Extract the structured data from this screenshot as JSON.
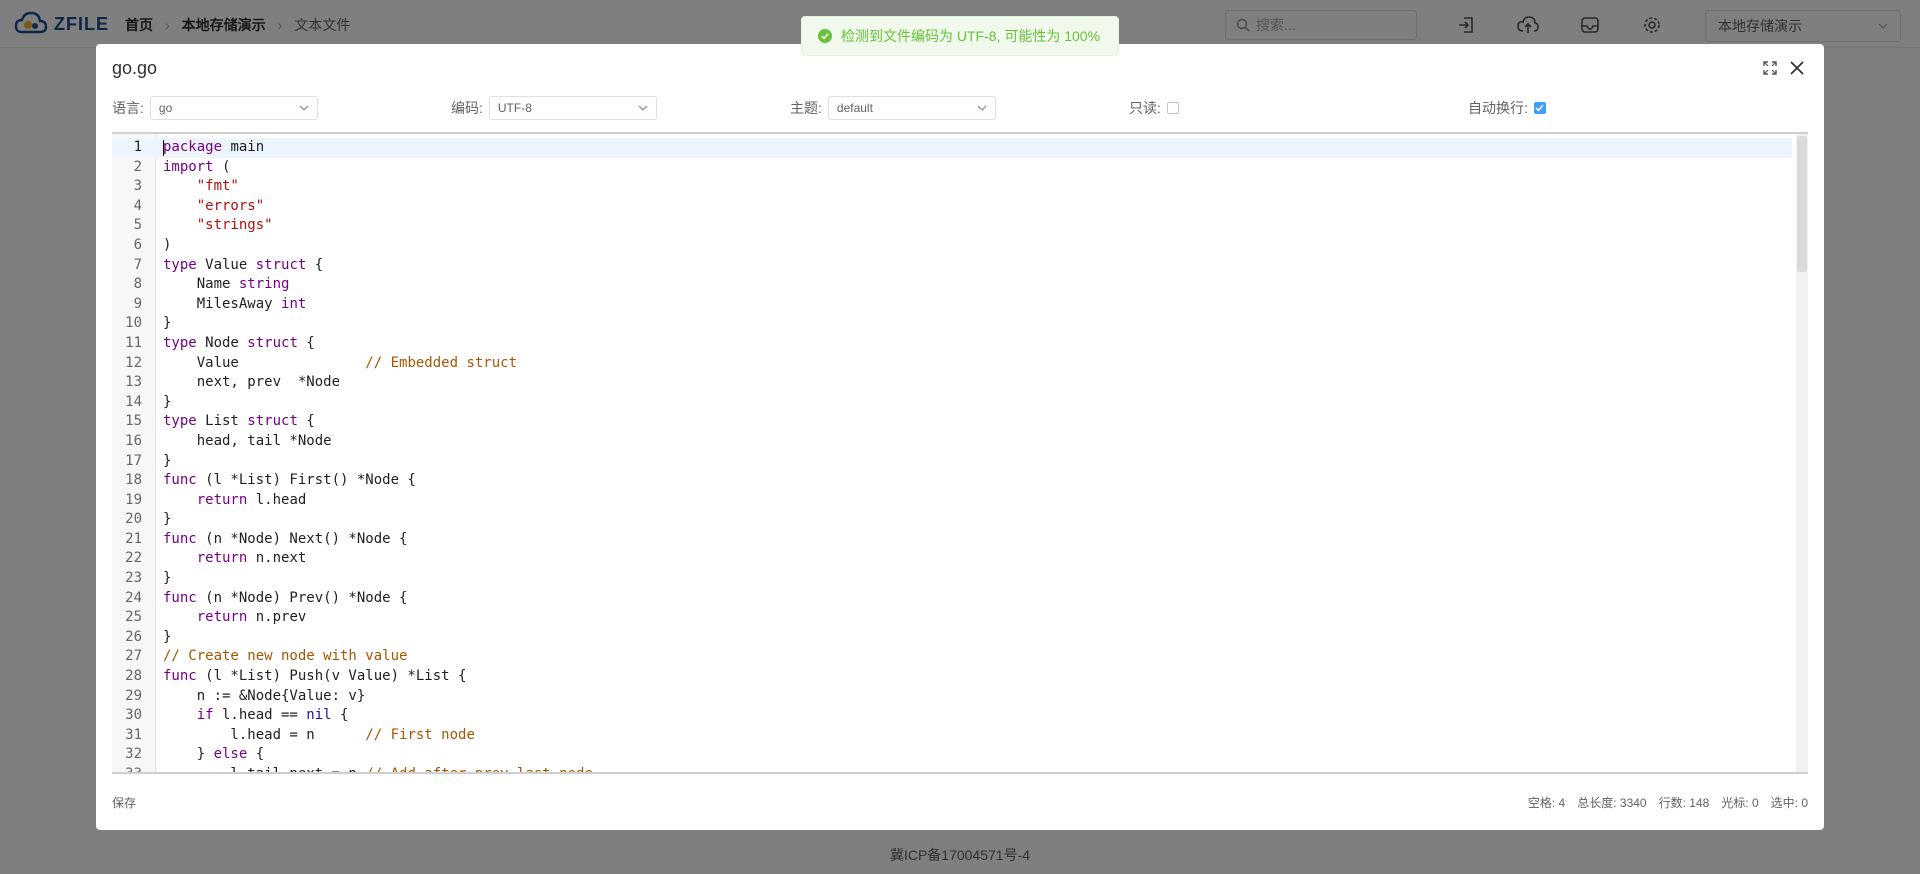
{
  "app": {
    "logo_text": "ZFILE",
    "breadcrumbs": [
      "首页",
      "本地存储演示",
      "文本文件"
    ],
    "search_placeholder": "搜索...",
    "storage_selected": "本地存储演示",
    "footer": "冀ICP备17004571号-4"
  },
  "toast": {
    "message": "检测到文件编码为 UTF-8, 可能性为 100%",
    "type": "success",
    "color": "#67c23a"
  },
  "dialog": {
    "title": "go.go",
    "toolbar": {
      "language_label": "语言:",
      "language_value": "go",
      "encoding_label": "编码:",
      "encoding_value": "UTF-8",
      "theme_label": "主题:",
      "theme_value": "default",
      "readonly_label": "只读:",
      "readonly_checked": false,
      "wrap_label": "自动换行:",
      "wrap_checked": true
    },
    "footer": {
      "save_label": "保存",
      "spaces": "空格: 4",
      "length": "总长度: 3340",
      "lines": "行数: 148",
      "cursor": "光标: 0",
      "selected": "选中: 0"
    }
  },
  "editor": {
    "active_line": 1,
    "lines": [
      [
        [
          "kw",
          "package"
        ],
        [
          "",
          " main"
        ]
      ],
      [
        [
          "kw",
          "import"
        ],
        [
          "",
          " ("
        ]
      ],
      [
        [
          "",
          "    "
        ],
        [
          "str",
          "\"fmt\""
        ]
      ],
      [
        [
          "",
          "    "
        ],
        [
          "str",
          "\"errors\""
        ]
      ],
      [
        [
          "",
          "    "
        ],
        [
          "str",
          "\"strings\""
        ]
      ],
      [
        [
          "",
          ")"
        ]
      ],
      [
        [
          "kw",
          "type"
        ],
        [
          "",
          " Value "
        ],
        [
          "kw",
          "struct"
        ],
        [
          "",
          " {"
        ]
      ],
      [
        [
          "",
          "    Name "
        ],
        [
          "ty",
          "string"
        ]
      ],
      [
        [
          "",
          "    MilesAway "
        ],
        [
          "ty",
          "int"
        ]
      ],
      [
        [
          "",
          "}"
        ]
      ],
      [
        [
          "kw",
          "type"
        ],
        [
          "",
          " Node "
        ],
        [
          "kw",
          "struct"
        ],
        [
          "",
          " {"
        ]
      ],
      [
        [
          "",
          "    Value               "
        ],
        [
          "cm",
          "// Embedded struct"
        ]
      ],
      [
        [
          "",
          "    next, prev  *Node"
        ]
      ],
      [
        [
          "",
          "}"
        ]
      ],
      [
        [
          "kw",
          "type"
        ],
        [
          "",
          " List "
        ],
        [
          "kw",
          "struct"
        ],
        [
          "",
          " {"
        ]
      ],
      [
        [
          "",
          "    head, tail *Node"
        ]
      ],
      [
        [
          "",
          "}"
        ]
      ],
      [
        [
          "kw",
          "func"
        ],
        [
          "",
          " (l *List) First() *Node {"
        ]
      ],
      [
        [
          "",
          "    "
        ],
        [
          "kw",
          "return"
        ],
        [
          "",
          " l.head"
        ]
      ],
      [
        [
          "",
          "}"
        ]
      ],
      [
        [
          "kw",
          "func"
        ],
        [
          "",
          " (n *Node) Next() *Node {"
        ]
      ],
      [
        [
          "",
          "    "
        ],
        [
          "kw",
          "return"
        ],
        [
          "",
          " n.next"
        ]
      ],
      [
        [
          "",
          "}"
        ]
      ],
      [
        [
          "kw",
          "func"
        ],
        [
          "",
          " (n *Node) Prev() *Node {"
        ]
      ],
      [
        [
          "",
          "    "
        ],
        [
          "kw",
          "return"
        ],
        [
          "",
          " n.prev"
        ]
      ],
      [
        [
          "",
          "}"
        ]
      ],
      [
        [
          "cm",
          "// Create new node with value"
        ]
      ],
      [
        [
          "kw",
          "func"
        ],
        [
          "",
          " (l *List) Push(v Value) *List {"
        ]
      ],
      [
        [
          "",
          "    n := &Node{Value: v}"
        ]
      ],
      [
        [
          "",
          "    "
        ],
        [
          "kw",
          "if"
        ],
        [
          "",
          " l.head == "
        ],
        [
          "nil",
          "nil"
        ],
        [
          "",
          " {"
        ]
      ],
      [
        [
          "",
          "        l.head = n      "
        ],
        [
          "cm",
          "// First node"
        ]
      ],
      [
        [
          "",
          "    } "
        ],
        [
          "kw",
          "else"
        ],
        [
          "",
          " {"
        ]
      ],
      [
        [
          "",
          "        l.tail.next = n "
        ],
        [
          "cm",
          "// Add after prev last node"
        ]
      ]
    ]
  }
}
